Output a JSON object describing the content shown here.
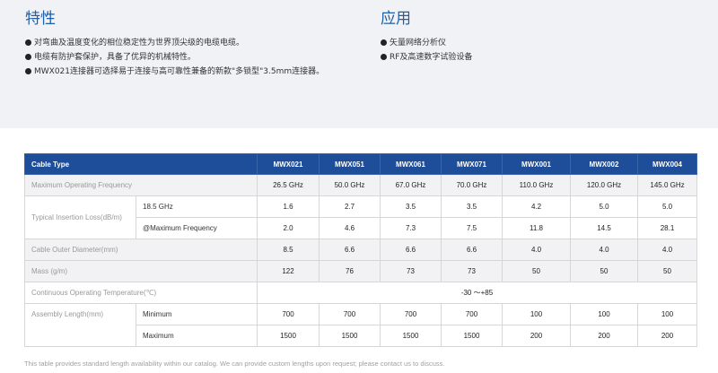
{
  "features": {
    "title": "特性",
    "items": [
      "对弯曲及温度变化的相位稳定性为世界顶尖级的电缆电缆。",
      "电缆有防护套保护，具备了优异的机械特性。",
      "MWX021连接器可选择易于连接与高可靠性兼备的新款\"多锁型\"3.5mm连接器。"
    ]
  },
  "applications": {
    "title": "应用",
    "items": [
      "矢量网络分析仪",
      "RF及高速数字试验设备"
    ]
  },
  "spec_table": {
    "header": {
      "label": "Cable Type",
      "models": [
        "MWX021",
        "MWX051",
        "MWX061",
        "MWX071",
        "MWX001",
        "MWX002",
        "MWX004"
      ]
    },
    "max_freq": {
      "label": "Maximum Operating Frequency",
      "values": [
        "26.5 GHz",
        "50.0 GHz",
        "67.0 GHz",
        "70.0 GHz",
        "110.0 GHz",
        "120.0 GHz",
        "145.0 GHz"
      ]
    },
    "insertion_loss": {
      "label": "Typical Insertion Loss(dB/m)",
      "rows": [
        {
          "sub": "18.5 GHz",
          "values": [
            "1.6",
            "2.7",
            "3.5",
            "3.5",
            "4.2",
            "5.0",
            "5.0"
          ]
        },
        {
          "sub": "@Maximum Frequency",
          "values": [
            "2.0",
            "4.6",
            "7.3",
            "7.5",
            "11.8",
            "14.5",
            "28.1"
          ]
        }
      ]
    },
    "outer_diameter": {
      "label": "Cable Outer Diameter(mm)",
      "values": [
        "8.5",
        "6.6",
        "6.6",
        "6.6",
        "4.0",
        "4.0",
        "4.0"
      ]
    },
    "mass": {
      "label": "Mass (g/m)",
      "values": [
        "122",
        "76",
        "73",
        "73",
        "50",
        "50",
        "50"
      ]
    },
    "temperature": {
      "label": "Continuous Operating Temperature(℃)",
      "value": "-30 ～+85"
    },
    "assembly_length": {
      "label": "Assembly Length(mm)",
      "rows": [
        {
          "sub": "Minimum",
          "values": [
            "700",
            "700",
            "700",
            "700",
            "100",
            "100",
            "100"
          ]
        },
        {
          "sub": "Maximum",
          "values": [
            "1500",
            "1500",
            "1500",
            "1500",
            "200",
            "200",
            "200"
          ]
        }
      ]
    }
  },
  "footnote": "This table provides standard length availability within our catalog. We can provide custom lengths upon request; please contact us to discuss."
}
